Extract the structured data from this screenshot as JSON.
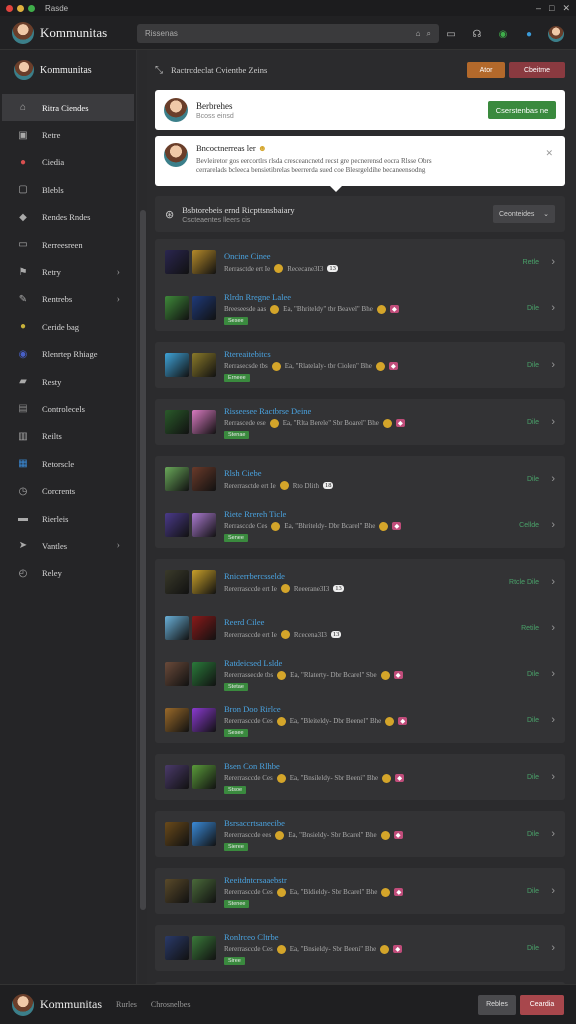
{
  "window": {
    "title": "Rasde"
  },
  "header": {
    "brand": "Kommunitas",
    "search_placeholder": "Rissenas",
    "icons": [
      "layout-icon",
      "headset-icon",
      "status-icon",
      "notification-icon"
    ]
  },
  "sidebar": {
    "brand": "Kommunitas",
    "items": [
      {
        "label": "Ritra Ciendes",
        "icon": "home-icon",
        "active": true
      },
      {
        "label": "Retre",
        "icon": "box-icon"
      },
      {
        "label": "Ciedia",
        "icon": "color-wheel-icon",
        "color": "#d94f4f"
      },
      {
        "label": "Blebls",
        "icon": "square-icon"
      },
      {
        "label": "Rendes Rndes",
        "icon": "tag-icon"
      },
      {
        "label": "Rerreesreen",
        "icon": "frame-icon"
      },
      {
        "label": "Retry",
        "icon": "flag-icon",
        "chevron": true
      },
      {
        "label": "Rentrebs",
        "icon": "pencil-icon",
        "chevron": true
      },
      {
        "label": "Ceride bag",
        "icon": "circle-icon",
        "color": "#c8b23a"
      },
      {
        "label": "Rlenrtep Rhiage",
        "icon": "planet-icon",
        "color": "#4860c8"
      },
      {
        "label": "Resty",
        "icon": "bookmark-icon"
      },
      {
        "label": "Controlecels",
        "icon": "window-icon",
        "color": "#888"
      },
      {
        "label": "Reilts",
        "icon": "clipboard-icon"
      },
      {
        "label": "Retorscle",
        "icon": "grid-icon",
        "color": "#3a8ad6"
      },
      {
        "label": "Corcrents",
        "icon": "clock-icon"
      },
      {
        "label": "Rierleis",
        "icon": "monitor-icon"
      },
      {
        "label": "Vantles",
        "icon": "arrow-icon",
        "chevron": true
      },
      {
        "label": "Reley",
        "icon": "gauge-icon"
      }
    ]
  },
  "topstrip": {
    "title": "Ractrcdeclat Cvientbe Zeins",
    "btn_a": "Ator",
    "btn_b": "Cbeitme"
  },
  "post": {
    "name": "Berbrehes",
    "sub": "Bcoss einsd",
    "button": "Cserstenbas ne"
  },
  "note": {
    "title": "Bncoctnerreas ler",
    "line1": "Bevleiretor gos eercortlrs rlsda cresceancnetd recst gre pecnerensd eocra Rlsse Obrs",
    "line2": "cerrarelads bcleeca bensietibrelas beerrerda sued coe Blesrgeldihe becaneensodng"
  },
  "filter": {
    "title": "Bsbtorebeis ernd Ricpttsnsbaiary",
    "sub": "Cscteaentes lleers cis",
    "select": "Ceonteides"
  },
  "groups": [
    {
      "rows": [
        {
          "title": "Oncine Cinee",
          "meta": "Rerrasctde ert Ie",
          "meta2": "Rececane3I3",
          "badge": "13",
          "right": "Retle",
          "thumbs": [
            "#2a2650",
            "#b58a2a"
          ],
          "type": "coin"
        },
        {
          "title": "Rlrdn Rregne Lalee",
          "meta": "Breeseesde aas",
          "meta2": "Ea, \"Bhriteldy\" tbr Beavel\" Bhe",
          "right": "Dile",
          "thumbs": [
            "#3f8a3a",
            "#1f3a7a"
          ],
          "type": "pill",
          "tag": "Sesee"
        }
      ]
    },
    {
      "rows": [
        {
          "title": "Rtereaitebitcs",
          "meta": "Rerrasecsde tbs",
          "meta2": "Ea, \"Rlatelaly- tbr Ciolen\" Bhe",
          "right": "Dile",
          "thumbs": [
            "#3fa3d8",
            "#8a7a2a"
          ],
          "type": "pill",
          "tag": "Erneee"
        }
      ]
    },
    {
      "rows": [
        {
          "title": "Risseesee Ractbrse Deine",
          "meta": "Rerrascede ese",
          "meta2": "Ea, \"Rlta Berele\" Sbr Boarel\" Bhe",
          "right": "Dile",
          "thumbs": [
            "#2a5a2a",
            "#d87ac0"
          ],
          "type": "pill",
          "tag": "Stenae"
        }
      ]
    },
    {
      "rows": [
        {
          "title": "Rlsh Ciebe",
          "meta": "Rererrasctde ert Ie",
          "meta2": "Rto Dlith",
          "badge": "18",
          "right": "Dile",
          "thumbs": [
            "#6aa85a",
            "#6a3a2a"
          ],
          "type": "coin"
        },
        {
          "title": "Riete Rrereh Ticle",
          "meta": "Rerrasccde Ces",
          "meta2": "Ea, \"Bhriteldy- Dbr Bcarel\" Bhe",
          "right": "Cellde",
          "thumbs": [
            "#4a3a8a",
            "#aa7ad0"
          ],
          "type": "pill",
          "tag": "Senee"
        }
      ]
    },
    {
      "rows": [
        {
          "title": "Rnicerrbercsselde",
          "meta": "Rererrasccde ert Ie",
          "meta2": "Reeerane3I3",
          "badge": "13",
          "right": "Rtcle Dile",
          "thumbs": [
            "#3a3a2a",
            "#c8a02a"
          ],
          "type": "coin"
        },
        {
          "title": "Reerd Cilee",
          "meta": "Rererrasccde ert Ie",
          "meta2": "Rcecena3I3",
          "badge": "13",
          "right": "Retile",
          "thumbs": [
            "#6ab0d8",
            "#8a1a1a"
          ],
          "type": "coin"
        },
        {
          "title": "Ratdeicsed Lslde",
          "meta": "Rererrassecde tbs",
          "meta2": "Ea, \"Rlaterty- Dbr Bcarel\" Sbe",
          "right": "Dile",
          "thumbs": [
            "#6a4a3a",
            "#2a7a3a"
          ],
          "type": "pill",
          "tag": "Stetae"
        },
        {
          "title": "Bron Doo Rirlce",
          "meta": "Rererrasccde Ces",
          "meta2": "Ea, \"Bleiteldy- Dbr Beenel\" Bhe",
          "right": "Dile",
          "thumbs": [
            "#9a6a2a",
            "#8a3ad0"
          ],
          "type": "pill",
          "tag": "Sesee"
        }
      ]
    },
    {
      "rows": [
        {
          "title": "Bsen Con Rlhbe",
          "meta": "Rererrasccde Ces",
          "meta2": "Ea, \"Bnsileldy- Sbr Beeni\" Bhe",
          "right": "Dile",
          "thumbs": [
            "#4a3a6a",
            "#5a9a3a"
          ],
          "type": "pill",
          "tag": "Stsoe"
        }
      ]
    },
    {
      "rows": [
        {
          "title": "Bsrsaccrtsanecibe",
          "meta": "Rererrasccde ees",
          "meta2": "Ea, \"Bnsieldy- Sbr Bcarel\" Bhe",
          "right": "Dile",
          "thumbs": [
            "#6a4a1a",
            "#3a8ad8"
          ],
          "type": "pill",
          "tag": "Sieree"
        }
      ]
    },
    {
      "rows": [
        {
          "title": "Reeitdntcrsaaebstr",
          "meta": "Rererrasccde Ces",
          "meta2": "Ea, \"Bldieldy- Sbr Bcarel\" Bhe",
          "right": "Dile",
          "thumbs": [
            "#5a4a2a",
            "#4a6a3a"
          ],
          "type": "pill",
          "tag": "Stenee"
        }
      ]
    },
    {
      "rows": [
        {
          "title": "Ronlrceo Cltrbe",
          "meta": "Rererrasccde Ces",
          "meta2": "Ea, \"Bnsieldy- Sbr Beeni\" Bhe",
          "right": "Dile",
          "thumbs": [
            "#2a3a6a",
            "#3a7a3a"
          ],
          "type": "pill",
          "tag": "Siree"
        }
      ]
    },
    {
      "rows": [
        {
          "title": "Rancrrbtor Rtenmstelbss",
          "meta": "",
          "meta2": "",
          "right": "",
          "thumbs": [
            "#3a7ab0",
            "#a07a3a"
          ],
          "type": "none"
        }
      ]
    }
  ],
  "footer": {
    "brand": "Kommunitas",
    "link1": "Rurles",
    "link2": "Chrosnelbes",
    "btn1": "Rebles",
    "btn2": "Ceardia"
  }
}
